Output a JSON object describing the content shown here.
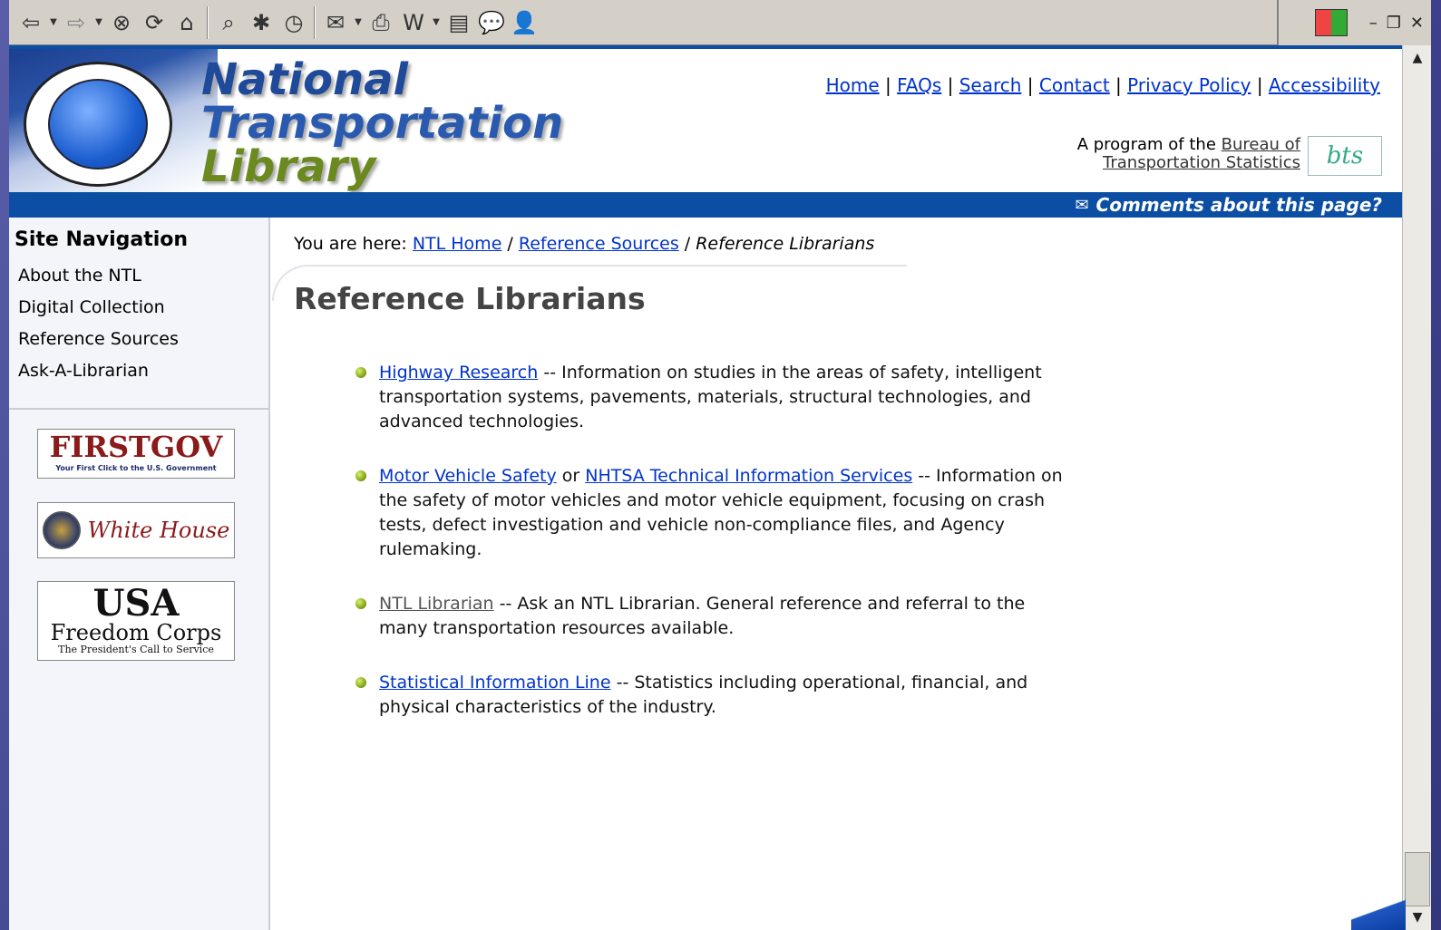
{
  "toolbar": {
    "buttons": [
      "back-icon",
      "forward-icon",
      "stop-icon",
      "refresh-icon",
      "home-icon",
      "search-icon",
      "favorites-icon",
      "history-icon",
      "mail-icon",
      "print-icon",
      "edit-icon",
      "discuss-icon",
      "messenger-icon"
    ]
  },
  "header": {
    "logo_line1": "National",
    "logo_line2": "Transportation",
    "logo_line3": "Library",
    "links": [
      "Home",
      "FAQs",
      "Search",
      "Contact",
      "Privacy Policy",
      "Accessibility"
    ],
    "program_prefix": "A program of the",
    "program_link_1": "Bureau of",
    "program_link_2": "Transportation Statistics",
    "comments": "Comments about this page?"
  },
  "sidebar": {
    "title": "Site Navigation",
    "items": [
      "About the NTL",
      "Digital Collection",
      "Reference Sources",
      "Ask-A-Librarian"
    ],
    "badge1_title": "FIRSTGOV",
    "badge1_sub": "Your First Click to the U.S. Government",
    "badge2_title": "White House",
    "badge3_title": "USA",
    "badge3_sub1": "Freedom Corps",
    "badge3_sub2": "The President's Call to Service"
  },
  "content": {
    "breadcrumb_prefix": "You are here:",
    "crumb1": "NTL Home",
    "crumb2": "Reference Sources",
    "crumb3": "Reference Librarians",
    "title": "Reference Librarians",
    "item1_link": "Highway Research",
    "item1_text": " -- Information on studies in the areas of safety, intelligent transportation systems, pavements, materials, structural technologies, and advanced technologies.",
    "item2_link1": "Motor Vehicle Safety",
    "item2_mid": " or ",
    "item2_link2": "NHTSA Technical Information Services",
    "item2_text": " -- Information on the safety of motor vehicles and motor vehicle equipment, focusing on crash tests, defect investigation and vehicle non-compliance files, and Agency rulemaking.",
    "item3_link": "NTL Librarian",
    "item3_text": " -- Ask an NTL Librarian. General reference and referral to the many transportation resources available.",
    "item4_link": "Statistical Information Line",
    "item4_text": " -- Statistics including operational, financial, and physical characteristics of the industry."
  }
}
